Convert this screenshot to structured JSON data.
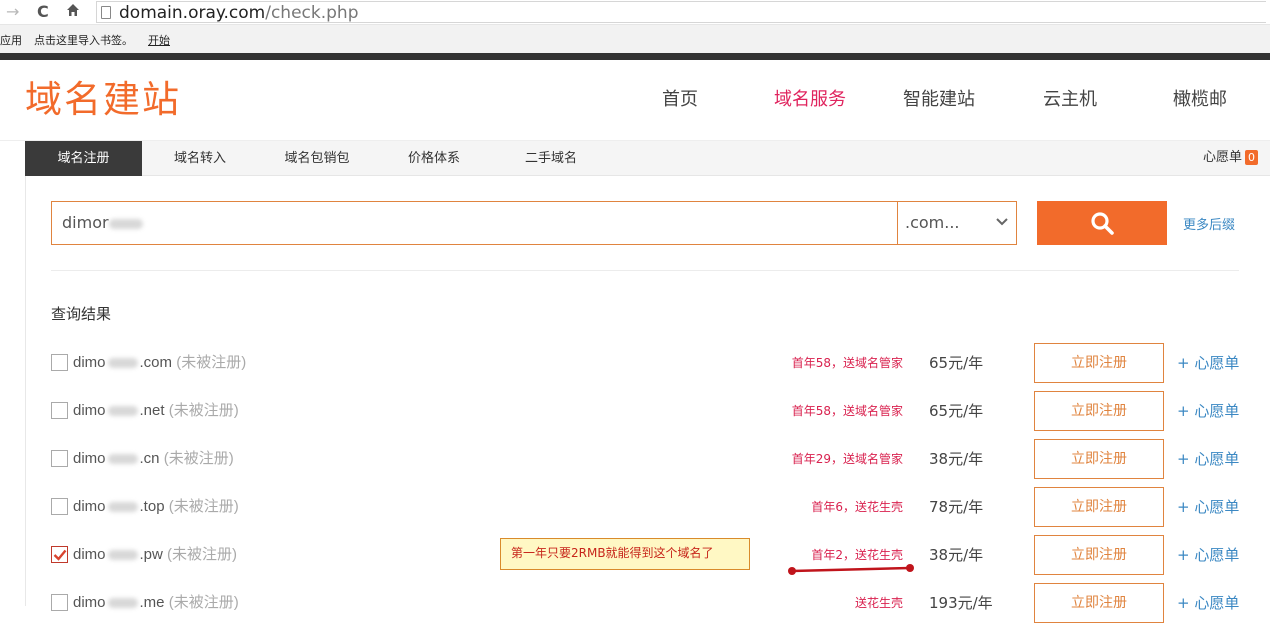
{
  "browser": {
    "url_domain": "domain.oray.com",
    "url_path": "/check.php",
    "bookmarks": {
      "apps": "应用",
      "import": "点击这里导入书签。",
      "start": "开始"
    }
  },
  "site": {
    "logo": "域名建站",
    "nav": [
      "首页",
      "域名服务",
      "智能建站",
      "云主机",
      "橄榄邮"
    ],
    "active_nav": "域名服务"
  },
  "subnav": {
    "items": [
      "域名注册",
      "域名转入",
      "域名包销包",
      "价格体系",
      "二手域名"
    ],
    "wishlist_label": "心愿单",
    "wishlist_count": "0"
  },
  "search": {
    "value_prefix": "dimor",
    "suffix": ".com...",
    "more_suffix": "更多后缀"
  },
  "results": {
    "title": "查询结果",
    "register_label": "立即注册",
    "wishlist_label": "+ 心愿单",
    "rows": [
      {
        "name": "dimo",
        "tld": ".com",
        "status": "(未被注册)",
        "promo": "首年58，送域名管家",
        "price": "65元/年",
        "checked": false
      },
      {
        "name": "dimo",
        "tld": ".net",
        "status": "(未被注册)",
        "promo": "首年58，送域名管家",
        "price": "65元/年",
        "checked": false
      },
      {
        "name": "dimo",
        "tld": ".cn",
        "status": "(未被注册)",
        "promo": "首年29，送域名管家",
        "price": "38元/年",
        "checked": false
      },
      {
        "name": "dimo",
        "tld": ".top",
        "status": "(未被注册)",
        "promo": "首年6，送花生壳",
        "price": "78元/年",
        "checked": false
      },
      {
        "name": "dimo",
        "tld": ".pw",
        "status": "(未被注册)",
        "promo": "首年2，送花生壳",
        "price": "38元/年",
        "checked": true
      },
      {
        "name": "dimo",
        "tld": ".me",
        "status": "(未被注册)",
        "promo": "送花生壳",
        "price": "193元/年",
        "checked": false
      }
    ]
  },
  "annotation": {
    "text": "第一年只要2RMB就能得到这个域名了",
    "color": "#c7261b"
  },
  "colors": {
    "brand_orange": "#f26b2b",
    "promo_red": "#d9224f",
    "link_blue": "#3b88c3"
  }
}
